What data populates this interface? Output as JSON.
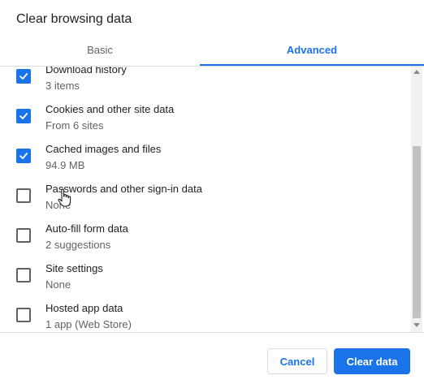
{
  "dialog": {
    "title": "Clear browsing data"
  },
  "tabs": [
    {
      "label": "Basic",
      "active": false
    },
    {
      "label": "Advanced",
      "active": true
    }
  ],
  "items": [
    {
      "label": "Download history",
      "sub": "3 items",
      "checked": true
    },
    {
      "label": "Cookies and other site data",
      "sub": "From 6 sites",
      "checked": true
    },
    {
      "label": "Cached images and files",
      "sub": "94.9 MB",
      "checked": true
    },
    {
      "label": "Passwords and other sign-in data",
      "sub": "None",
      "checked": false
    },
    {
      "label": "Auto-fill form data",
      "sub": "2 suggestions",
      "checked": false
    },
    {
      "label": "Site settings",
      "sub": "None",
      "checked": false
    },
    {
      "label": "Hosted app data",
      "sub": "1 app (Web Store)",
      "checked": false
    }
  ],
  "buttons": {
    "cancel": "Cancel",
    "clear": "Clear data"
  },
  "colors": {
    "accent": "#1a73e8"
  }
}
